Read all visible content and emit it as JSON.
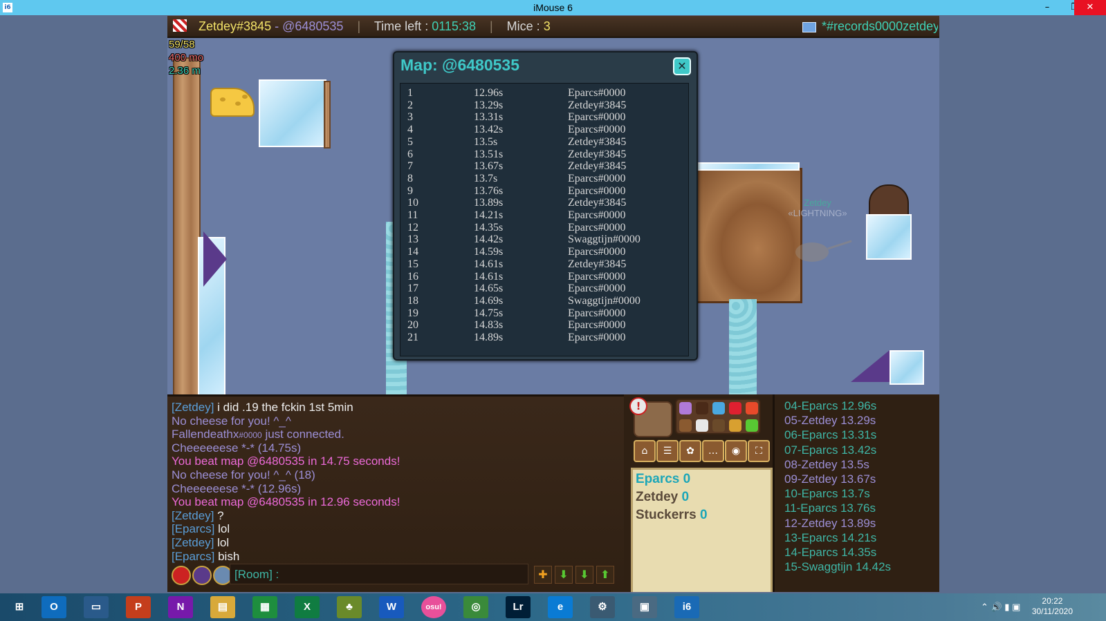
{
  "window": {
    "title": "iMouse 6",
    "app_icon": "i6",
    "minimize": "–",
    "restore": "❐",
    "close": "✕"
  },
  "topbar": {
    "player": "Zetdey#3845",
    "dash": " - ",
    "map": "@6480535",
    "sep": "|",
    "time_label": "Time left :",
    "time_value": "0115:38",
    "mice_label": "Mice :",
    "mice_value": "3",
    "room": "*#records0000zetdey"
  },
  "stats": {
    "ratio": "59/58",
    "distance1": "400 mo",
    "distance2": "2.36 m"
  },
  "mouse_nametag": {
    "name": "Zetdey",
    "title": "«LIGHTNING»"
  },
  "map_popup": {
    "title": "Map: @6480535",
    "close": "✕",
    "records": [
      {
        "rank": "1",
        "time": "12.96s",
        "player": "Eparcs#0000"
      },
      {
        "rank": "2",
        "time": "13.29s",
        "player": "Zetdey#3845"
      },
      {
        "rank": "3",
        "time": "13.31s",
        "player": "Eparcs#0000"
      },
      {
        "rank": "4",
        "time": "13.42s",
        "player": "Eparcs#0000"
      },
      {
        "rank": "5",
        "time": "13.5s",
        "player": "Zetdey#3845"
      },
      {
        "rank": "6",
        "time": "13.51s",
        "player": "Zetdey#3845"
      },
      {
        "rank": "7",
        "time": "13.67s",
        "player": "Zetdey#3845"
      },
      {
        "rank": "8",
        "time": "13.7s",
        "player": "Eparcs#0000"
      },
      {
        "rank": "9",
        "time": "13.76s",
        "player": "Eparcs#0000"
      },
      {
        "rank": "10",
        "time": "13.89s",
        "player": "Zetdey#3845"
      },
      {
        "rank": "11",
        "time": "14.21s",
        "player": "Eparcs#0000"
      },
      {
        "rank": "12",
        "time": "14.35s",
        "player": "Eparcs#0000"
      },
      {
        "rank": "13",
        "time": "14.42s",
        "player": "Swaggtijn#0000"
      },
      {
        "rank": "14",
        "time": "14.59s",
        "player": "Eparcs#0000"
      },
      {
        "rank": "15",
        "time": "14.61s",
        "player": "Zetdey#3845"
      },
      {
        "rank": "16",
        "time": "14.61s",
        "player": "Eparcs#0000"
      },
      {
        "rank": "17",
        "time": "14.65s",
        "player": "Eparcs#0000"
      },
      {
        "rank": "18",
        "time": "14.69s",
        "player": "Swaggtijn#0000"
      },
      {
        "rank": "19",
        "time": "14.75s",
        "player": "Eparcs#0000"
      },
      {
        "rank": "20",
        "time": "14.83s",
        "player": "Eparcs#0000"
      },
      {
        "rank": "21",
        "time": "14.89s",
        "player": "Eparcs#0000"
      }
    ]
  },
  "chat": {
    "lines": [
      {
        "name": "[Zetdey]",
        "text": " i did .19 the fckin 1st 5min",
        "kind": "user"
      },
      {
        "name": "",
        "text": "No cheese for you! ^_^",
        "kind": "sys"
      },
      {
        "name": "",
        "text": "Fallendeathx",
        "tag": "#0000",
        "tail": " just connected.",
        "kind": "connect"
      },
      {
        "name": "",
        "text": "Cheeeeeese *-* (14.75s)",
        "kind": "sys"
      },
      {
        "name": "",
        "text": "You beat map @6480535 in 14.75 seconds!",
        "kind": "win"
      },
      {
        "name": "",
        "text": "No cheese for you! ^_^ (18)",
        "kind": "sys"
      },
      {
        "name": "",
        "text": "Cheeeeeese *-* (12.96s)",
        "kind": "sys"
      },
      {
        "name": "",
        "text": "You beat map @6480535 in 12.96 seconds!",
        "kind": "win"
      },
      {
        "name": "[Zetdey]",
        "text": " ?",
        "kind": "user"
      },
      {
        "name": "[Eparcs]",
        "text": " lol",
        "kind": "user"
      },
      {
        "name": "[Zetdey]",
        "text": " lol",
        "kind": "user"
      },
      {
        "name": "[Eparcs]",
        "text": " bish",
        "kind": "user"
      }
    ],
    "input_placeholder": "[Room] :",
    "icons": [
      "heart-icon",
      "shaman-badge-icon",
      "cheese-badge-icon"
    ],
    "arrows": [
      "✚",
      "⬇",
      "⬇",
      "⬆"
    ]
  },
  "tools": {
    "warn": "!",
    "menu_icons": [
      "⌂",
      "☰",
      "✿",
      "…",
      "◉",
      "⛶"
    ]
  },
  "scoreboard": [
    {
      "name": "Eparcs",
      "score": "0",
      "highlight": true
    },
    {
      "name": "Zetdey",
      "score": "0",
      "highlight": false
    },
    {
      "name": "Stuckerrs",
      "score": "0",
      "highlight": false
    }
  ],
  "leaderboard": [
    {
      "text": "04-Eparcs 12.96s",
      "who": "e"
    },
    {
      "text": "05-Zetdey 13.29s",
      "who": "z"
    },
    {
      "text": "06-Eparcs 13.31s",
      "who": "e"
    },
    {
      "text": "07-Eparcs 13.42s",
      "who": "e"
    },
    {
      "text": "08-Zetdey 13.5s",
      "who": "z"
    },
    {
      "text": "09-Zetdey 13.67s",
      "who": "z"
    },
    {
      "text": "10-Eparcs 13.7s",
      "who": "e"
    },
    {
      "text": "11-Eparcs 13.76s",
      "who": "e"
    },
    {
      "text": "12-Zetdey 13.89s",
      "who": "z"
    },
    {
      "text": "13-Eparcs 14.21s",
      "who": "e"
    },
    {
      "text": "14-Eparcs 14.35s",
      "who": "e"
    },
    {
      "text": "15-Swaggtijn 14.42s",
      "who": "s"
    }
  ],
  "taskbar": {
    "apps": [
      {
        "label": "⊞",
        "name": "start-button"
      },
      {
        "label": "O",
        "name": "outlook-icon",
        "color": "#0f6cbd"
      },
      {
        "label": "▭",
        "name": "lenovo-icon",
        "color": "#2a5a8a"
      },
      {
        "label": "P",
        "name": "powerpoint-icon",
        "color": "#c43e1c"
      },
      {
        "label": "N",
        "name": "onenote-icon",
        "color": "#7719aa"
      },
      {
        "label": "▤",
        "name": "file-explorer-icon",
        "color": "#d8a93a"
      },
      {
        "label": "▦",
        "name": "sheets-icon",
        "color": "#1e8e3e"
      },
      {
        "label": "X",
        "name": "excel-icon",
        "color": "#107c41"
      },
      {
        "label": "♣",
        "name": "pineapple-app-icon",
        "color": "#6a8a2a"
      },
      {
        "label": "W",
        "name": "word-icon",
        "color": "#185abd"
      },
      {
        "label": "osu!",
        "name": "osu-icon",
        "color": "#e8509a"
      },
      {
        "label": "◎",
        "name": "chrome-icon",
        "color": "#3a8a3a"
      },
      {
        "label": "Lr",
        "name": "lightroom-icon",
        "color": "#001e36"
      },
      {
        "label": "e",
        "name": "edge-icon",
        "color": "#0a7bd4"
      },
      {
        "label": "⚙",
        "name": "settings-icon",
        "color": "#3a5a72"
      },
      {
        "label": "▣",
        "name": "photos-icon",
        "color": "#4a6a82"
      },
      {
        "label": "i6",
        "name": "imouse-taskbar-icon",
        "color": "#1a6ab5"
      }
    ],
    "tray": "⌃  🔊  ▮  ▣",
    "time": "20:22",
    "date": "30/11/2020"
  }
}
